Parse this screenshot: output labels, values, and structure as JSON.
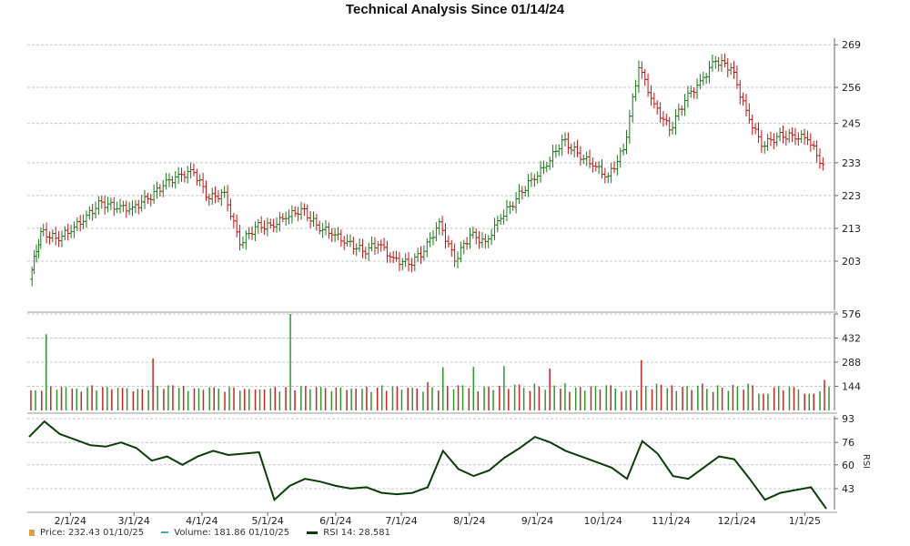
{
  "chart_data": {
    "title": "Technical Analysis Since 01/14/24",
    "x_tick_labels": [
      "2/1/24",
      "3/1/24",
      "4/1/24",
      "5/1/24",
      "6/1/24",
      "7/1/24",
      "8/1/24",
      "9/1/24",
      "10/1/24",
      "11/1/24",
      "12/1/24",
      "1/1/25"
    ],
    "panels": [
      {
        "type": "ohlc",
        "name": "Price",
        "y_ticks": [
          203,
          213,
          223,
          233,
          245,
          256,
          269
        ],
        "ylim": [
          188,
          271
        ],
        "up_color": "#1a7a1a",
        "down_color": "#cc1111",
        "series": [
          {
            "date": "1/14/24",
            "close": 197.5
          },
          {
            "date": "1/19/24",
            "close": 212
          },
          {
            "date": "1/26/24",
            "close": 210
          },
          {
            "date": "2/2/24",
            "close": 212
          },
          {
            "date": "2/9/24",
            "close": 217
          },
          {
            "date": "2/16/24",
            "close": 221
          },
          {
            "date": "2/23/24",
            "close": 219
          },
          {
            "date": "3/1/24",
            "close": 219.5
          },
          {
            "date": "3/8/24",
            "close": 222
          },
          {
            "date": "3/15/24",
            "close": 226
          },
          {
            "date": "3/22/24",
            "close": 229.5
          },
          {
            "date": "3/29/24",
            "close": 230
          },
          {
            "date": "4/5/24",
            "close": 222
          },
          {
            "date": "4/12/24",
            "close": 224
          },
          {
            "date": "4/19/24",
            "close": 208
          },
          {
            "date": "4/26/24",
            "close": 213.5
          },
          {
            "date": "5/3/24",
            "close": 214
          },
          {
            "date": "5/10/24",
            "close": 216
          },
          {
            "date": "5/17/24",
            "close": 219
          },
          {
            "date": "5/24/24",
            "close": 214
          },
          {
            "date": "5/31/24",
            "close": 211
          },
          {
            "date": "6/7/24",
            "close": 209
          },
          {
            "date": "6/14/24",
            "close": 206
          },
          {
            "date": "6/21/24",
            "close": 208
          },
          {
            "date": "6/28/24",
            "close": 204
          },
          {
            "date": "7/5/24",
            "close": 202
          },
          {
            "date": "7/12/24",
            "close": 206
          },
          {
            "date": "7/19/24",
            "close": 215
          },
          {
            "date": "7/26/24",
            "close": 203
          },
          {
            "date": "8/2/24",
            "close": 211
          },
          {
            "date": "8/9/24",
            "close": 209
          },
          {
            "date": "8/16/24",
            "close": 216
          },
          {
            "date": "8/23/24",
            "close": 222
          },
          {
            "date": "8/30/24",
            "close": 228
          },
          {
            "date": "9/6/24",
            "close": 232
          },
          {
            "date": "9/13/24",
            "close": 240
          },
          {
            "date": "9/20/24",
            "close": 236
          },
          {
            "date": "9/27/24",
            "close": 232
          },
          {
            "date": "10/4/24",
            "close": 229
          },
          {
            "date": "10/11/24",
            "close": 237
          },
          {
            "date": "10/18/24",
            "close": 262
          },
          {
            "date": "10/25/24",
            "close": 251
          },
          {
            "date": "11/1/24",
            "close": 243
          },
          {
            "date": "11/8/24",
            "close": 252
          },
          {
            "date": "11/15/24",
            "close": 258
          },
          {
            "date": "11/22/24",
            "close": 264
          },
          {
            "date": "11/29/24",
            "close": 262
          },
          {
            "date": "12/6/24",
            "close": 249
          },
          {
            "date": "12/13/24",
            "close": 238
          },
          {
            "date": "12/20/24",
            "close": 241
          },
          {
            "date": "12/27/24",
            "close": 241.5
          },
          {
            "date": "1/3/25",
            "close": 240
          },
          {
            "date": "1/10/25",
            "close": 232.43
          }
        ]
      },
      {
        "type": "bar",
        "name": "Volume",
        "y_ticks": [
          144,
          288,
          432,
          576
        ],
        "ylim": [
          0,
          576
        ],
        "color_note": "green on up days, red on down days",
        "values": [
          120,
          455,
          140,
          130,
          150,
          140,
          135,
          128,
          310,
          150,
          145,
          132,
          138,
          140,
          128,
          125,
          140,
          576,
          145,
          140,
          138,
          130,
          142,
          150,
          142,
          136,
          170,
          258,
          150,
          260,
          140,
          265,
          155,
          160,
          250,
          162,
          140,
          145,
          150,
          120,
          300,
          160,
          150,
          145,
          160,
          150,
          152,
          160,
          100,
          145,
          140,
          100,
          181.86
        ]
      },
      {
        "type": "line",
        "name": "RSI 14",
        "ylabel": "RSI",
        "y_ticks": [
          43,
          60,
          76,
          93
        ],
        "ylim": [
          28,
          95
        ],
        "color": "#0a3d0a",
        "values": [
          80,
          91,
          82,
          78,
          74,
          73,
          76,
          72,
          63,
          66,
          60,
          66,
          70,
          67,
          68,
          69,
          35,
          45,
          50,
          48,
          45,
          43,
          44,
          40,
          39,
          40,
          44,
          70,
          57,
          52,
          56,
          65,
          72,
          80,
          76,
          70,
          66,
          62,
          58,
          50,
          77,
          68,
          52,
          50,
          58,
          66,
          64,
          50,
          35,
          40,
          42,
          44,
          28.581
        ]
      }
    ],
    "legend": [
      {
        "label": "Price:",
        "value": "232.43",
        "date": "01/10/25",
        "color": "#e0a040",
        "marker": "square"
      },
      {
        "label": "Volume:",
        "value": "181.86",
        "date": "01/10/25",
        "color": "#44aaaa",
        "marker": "dash"
      },
      {
        "label": "RSI 14:",
        "value": "28.581",
        "color": "#0a3d0a",
        "marker": "line"
      }
    ]
  }
}
